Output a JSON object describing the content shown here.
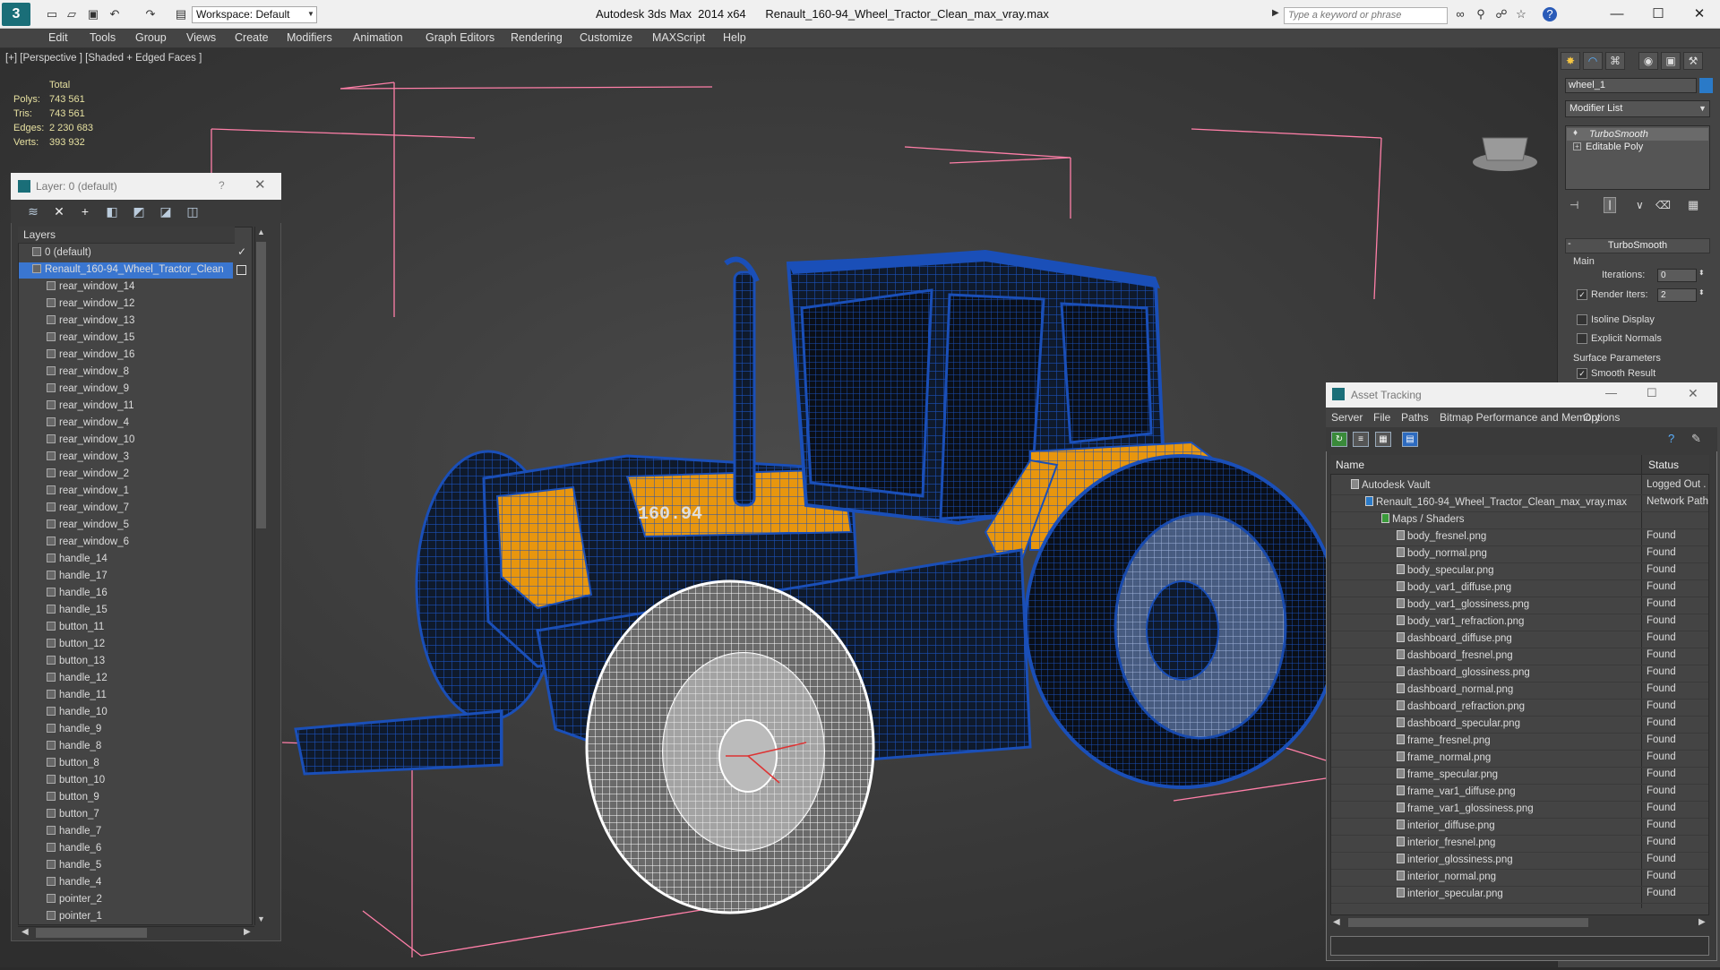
{
  "titlebar": {
    "app_logo": "3",
    "workspace": "Workspace: Default",
    "title": "Autodesk 3ds Max  2014 x64      Renault_160-94_Wheel_Tractor_Clean_max_vray.max",
    "search_placeholder": "Type a keyword or phrase"
  },
  "menu": [
    "Edit",
    "Tools",
    "Group",
    "Views",
    "Create",
    "Modifiers",
    "Animation",
    "Graph Editors",
    "Rendering",
    "Customize",
    "MAXScript",
    "Help"
  ],
  "viewport": {
    "label": "[+] [Perspective ] [Shaded + Edged Faces ]",
    "stats": {
      "total_label": "Total",
      "rows": [
        {
          "label": "Polys:",
          "value": "743 561"
        },
        {
          "label": "Tris:",
          "value": "743 561"
        },
        {
          "label": "Edges:",
          "value": "2 230 683"
        },
        {
          "label": "Verts:",
          "value": "393 932"
        }
      ]
    },
    "plate_text": "160.94"
  },
  "layer_panel": {
    "title": "Layer: 0 (default)",
    "help": "?",
    "header": "Layers",
    "rows": [
      {
        "label": "0 (default)",
        "indent": 1
      },
      {
        "label": "Renault_160-94_Wheel_Tractor_Clean",
        "indent": 1,
        "selected": true
      },
      {
        "label": "rear_window_14",
        "indent": 2
      },
      {
        "label": "rear_window_12",
        "indent": 2
      },
      {
        "label": "rear_window_13",
        "indent": 2
      },
      {
        "label": "rear_window_15",
        "indent": 2
      },
      {
        "label": "rear_window_16",
        "indent": 2
      },
      {
        "label": "rear_window_8",
        "indent": 2
      },
      {
        "label": "rear_window_9",
        "indent": 2
      },
      {
        "label": "rear_window_11",
        "indent": 2
      },
      {
        "label": "rear_window_4",
        "indent": 2
      },
      {
        "label": "rear_window_10",
        "indent": 2
      },
      {
        "label": "rear_window_3",
        "indent": 2
      },
      {
        "label": "rear_window_2",
        "indent": 2
      },
      {
        "label": "rear_window_1",
        "indent": 2
      },
      {
        "label": "rear_window_7",
        "indent": 2
      },
      {
        "label": "rear_window_5",
        "indent": 2
      },
      {
        "label": "rear_window_6",
        "indent": 2
      },
      {
        "label": "handle_14",
        "indent": 2
      },
      {
        "label": "handle_17",
        "indent": 2
      },
      {
        "label": "handle_16",
        "indent": 2
      },
      {
        "label": "handle_15",
        "indent": 2
      },
      {
        "label": "button_11",
        "indent": 2
      },
      {
        "label": "button_12",
        "indent": 2
      },
      {
        "label": "button_13",
        "indent": 2
      },
      {
        "label": "handle_12",
        "indent": 2
      },
      {
        "label": "handle_11",
        "indent": 2
      },
      {
        "label": "handle_10",
        "indent": 2
      },
      {
        "label": "handle_9",
        "indent": 2
      },
      {
        "label": "handle_8",
        "indent": 2
      },
      {
        "label": "button_8",
        "indent": 2
      },
      {
        "label": "button_10",
        "indent": 2
      },
      {
        "label": "button_9",
        "indent": 2
      },
      {
        "label": "button_7",
        "indent": 2
      },
      {
        "label": "handle_7",
        "indent": 2
      },
      {
        "label": "handle_6",
        "indent": 2
      },
      {
        "label": "handle_5",
        "indent": 2
      },
      {
        "label": "handle_4",
        "indent": 2
      },
      {
        "label": "pointer_2",
        "indent": 2
      },
      {
        "label": "pointer_1",
        "indent": 2
      }
    ]
  },
  "command_panel": {
    "object_name": "wheel_1",
    "modifier_list": "Modifier List",
    "stack": [
      "TurboSmooth",
      "Editable Poly"
    ],
    "rollout": "TurboSmooth",
    "main_label": "Main",
    "iterations_label": "Iterations:",
    "iterations_value": "0",
    "render_iters_label": "Render Iters:",
    "render_iters_value": "2",
    "isoline_label": "Isoline Display",
    "explicit_label": "Explicit Normals",
    "surface_label": "Surface Parameters",
    "smooth_label": "Smooth Result"
  },
  "asset_tracking": {
    "title": "Asset Tracking",
    "menu": [
      "Server",
      "File",
      "Paths",
      "Bitmap Performance and Memory",
      "Options"
    ],
    "col_name": "Name",
    "col_status": "Status",
    "rows": [
      {
        "name": "Autodesk Vault",
        "indent": 1,
        "status": "Logged Out ."
      },
      {
        "name": "Renault_160-94_Wheel_Tractor_Clean_max_vray.max",
        "indent": 2,
        "status": "Network Path"
      },
      {
        "name": "Maps / Shaders",
        "indent": 3,
        "status": ""
      },
      {
        "name": "body_fresnel.png",
        "indent": 4,
        "status": "Found"
      },
      {
        "name": "body_normal.png",
        "indent": 4,
        "status": "Found"
      },
      {
        "name": "body_specular.png",
        "indent": 4,
        "status": "Found"
      },
      {
        "name": "body_var1_diffuse.png",
        "indent": 4,
        "status": "Found"
      },
      {
        "name": "body_var1_glossiness.png",
        "indent": 4,
        "status": "Found"
      },
      {
        "name": "body_var1_refraction.png",
        "indent": 4,
        "status": "Found"
      },
      {
        "name": "dashboard_diffuse.png",
        "indent": 4,
        "status": "Found"
      },
      {
        "name": "dashboard_fresnel.png",
        "indent": 4,
        "status": "Found"
      },
      {
        "name": "dashboard_glossiness.png",
        "indent": 4,
        "status": "Found"
      },
      {
        "name": "dashboard_normal.png",
        "indent": 4,
        "status": "Found"
      },
      {
        "name": "dashboard_refraction.png",
        "indent": 4,
        "status": "Found"
      },
      {
        "name": "dashboard_specular.png",
        "indent": 4,
        "status": "Found"
      },
      {
        "name": "frame_fresnel.png",
        "indent": 4,
        "status": "Found"
      },
      {
        "name": "frame_normal.png",
        "indent": 4,
        "status": "Found"
      },
      {
        "name": "frame_specular.png",
        "indent": 4,
        "status": "Found"
      },
      {
        "name": "frame_var1_diffuse.png",
        "indent": 4,
        "status": "Found"
      },
      {
        "name": "frame_var1_glossiness.png",
        "indent": 4,
        "status": "Found"
      },
      {
        "name": "interior_diffuse.png",
        "indent": 4,
        "status": "Found"
      },
      {
        "name": "interior_fresnel.png",
        "indent": 4,
        "status": "Found"
      },
      {
        "name": "interior_glossiness.png",
        "indent": 4,
        "status": "Found"
      },
      {
        "name": "interior_normal.png",
        "indent": 4,
        "status": "Found"
      },
      {
        "name": "interior_specular.png",
        "indent": 4,
        "status": "Found"
      }
    ]
  },
  "colors": {
    "wire_blue": "#1a4fb8",
    "body_orange": "#e8960e",
    "selection_blue": "#3a76d0",
    "bbox_pink": "#ff7fa8",
    "stat_yellow": "#e6e0a0"
  }
}
